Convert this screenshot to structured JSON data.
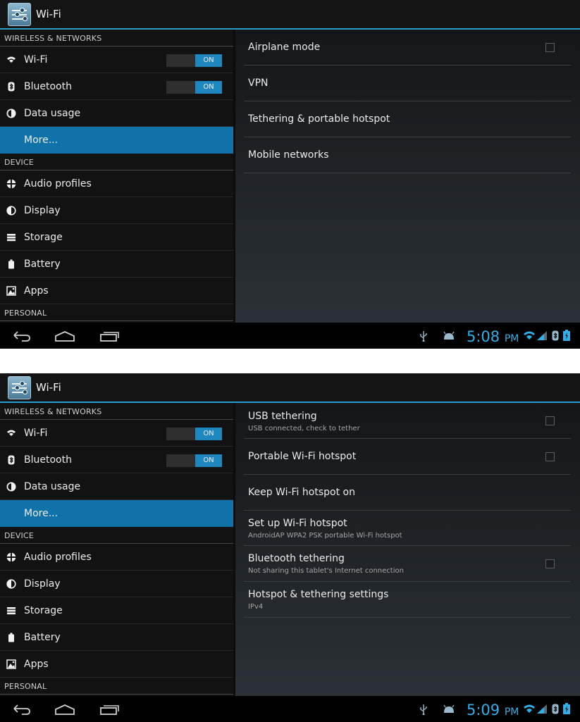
{
  "screens": [
    {
      "app_title": "Wi-Fi",
      "sections": {
        "wireless": "WIRELESS & NETWORKS",
        "device": "DEVICE",
        "personal": "PERSONAL"
      },
      "nav_items": [
        {
          "label": "Wi-Fi",
          "icon": "wifi-icon",
          "toggle": "ON"
        },
        {
          "label": "Bluetooth",
          "icon": "bluetooth-icon",
          "toggle": "ON"
        },
        {
          "label": "Data usage",
          "icon": "data-usage-icon"
        },
        {
          "label": "More...",
          "selected": true
        },
        {
          "label": "Audio profiles",
          "icon": "audio-profiles-icon"
        },
        {
          "label": "Display",
          "icon": "display-icon"
        },
        {
          "label": "Storage",
          "icon": "storage-icon"
        },
        {
          "label": "Battery",
          "icon": "battery-icon"
        },
        {
          "label": "Apps",
          "icon": "apps-icon"
        }
      ],
      "prefs": [
        {
          "title": "Airplane mode",
          "checkbox": true
        },
        {
          "title": "VPN"
        },
        {
          "title": "Tethering & portable hotspot"
        },
        {
          "title": "Mobile networks"
        }
      ],
      "status": {
        "time": "5:08",
        "ampm": "PM"
      }
    },
    {
      "app_title": "Wi-Fi",
      "sections": {
        "wireless": "WIRELESS & NETWORKS",
        "device": "DEVICE",
        "personal": "PERSONAL"
      },
      "nav_items": [
        {
          "label": "Wi-Fi",
          "icon": "wifi-icon",
          "toggle": "ON"
        },
        {
          "label": "Bluetooth",
          "icon": "bluetooth-icon",
          "toggle": "ON"
        },
        {
          "label": "Data usage",
          "icon": "data-usage-icon"
        },
        {
          "label": "More...",
          "selected": true
        },
        {
          "label": "Audio profiles",
          "icon": "audio-profiles-icon"
        },
        {
          "label": "Display",
          "icon": "display-icon"
        },
        {
          "label": "Storage",
          "icon": "storage-icon"
        },
        {
          "label": "Battery",
          "icon": "battery-icon"
        },
        {
          "label": "Apps",
          "icon": "apps-icon"
        }
      ],
      "prefs": [
        {
          "title": "USB tethering",
          "summary": "USB connected, check to tether",
          "checkbox": true
        },
        {
          "title": "Portable Wi-Fi hotspot",
          "checkbox": true
        },
        {
          "title": "Keep Wi-Fi hotspot on"
        },
        {
          "title": "Set up Wi-Fi hotspot",
          "summary": "AndroidAP WPA2 PSK portable Wi-Fi hotspot"
        },
        {
          "title": "Bluetooth tethering",
          "summary": "Not sharing this tablet's Internet connection",
          "checkbox": true
        },
        {
          "title": "Hotspot & tethering settings",
          "summary": "IPv4"
        }
      ],
      "status": {
        "time": "5:09",
        "ampm": "PM"
      }
    }
  ]
}
